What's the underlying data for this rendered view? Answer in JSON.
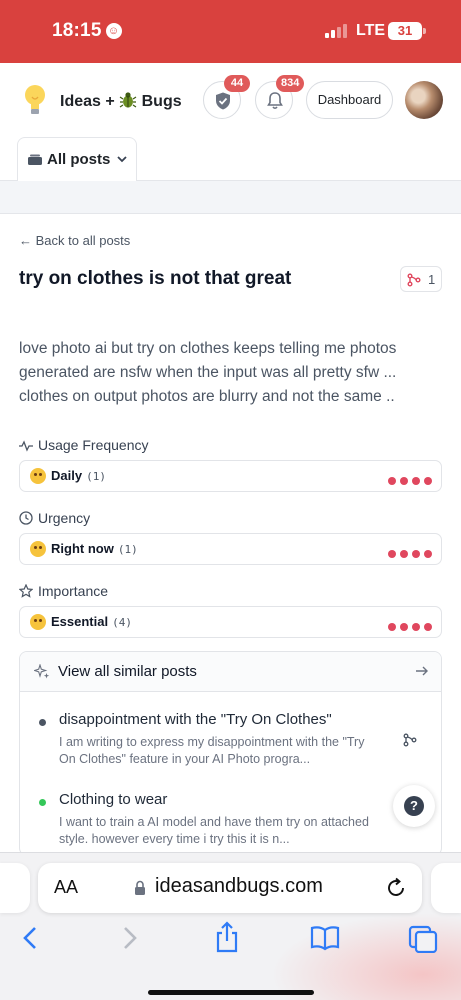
{
  "status_bar": {
    "time": "18:15",
    "network": "LTE",
    "battery": "31"
  },
  "header": {
    "brand": "Ideas + ",
    "brand_suffix": "Bugs",
    "shield_badge": "44",
    "bell_badge": "834",
    "dashboard_label": "Dashboard"
  },
  "tabs": {
    "active": "All posts"
  },
  "post": {
    "back_label": "Back to all posts",
    "title": "try on clothes is not that great",
    "merge_count": "1",
    "body": "love photo ai but try on clothes keeps telling me photos generated are nsfw when the input was all pretty sfw ... clothes on output photos are blurry and not the same .."
  },
  "fields": [
    {
      "label": "Usage Frequency",
      "value": "Daily",
      "count": "(1)",
      "level": 4
    },
    {
      "label": "Urgency",
      "value": "Right now",
      "count": "(1)",
      "level": 4
    },
    {
      "label": "Importance",
      "value": "Essential",
      "count": "(4)",
      "level": 4
    }
  ],
  "similar": {
    "header": "View all similar posts",
    "items": [
      {
        "title": "disappointment with the \"Try On Clothes\"",
        "description": "I am writing to express my disappointment with the \"Try On Clothes\" feature in your AI Photo progra...",
        "dot_color": "#4b5563"
      },
      {
        "title": "Clothing to wear",
        "description": "I want to train a AI model and have them try on attached style. however every time i try this it is n...",
        "dot_color": "#34c759"
      }
    ]
  },
  "help_label": "?",
  "browser": {
    "text_size": "AA",
    "url": "ideasandbugs.com"
  }
}
